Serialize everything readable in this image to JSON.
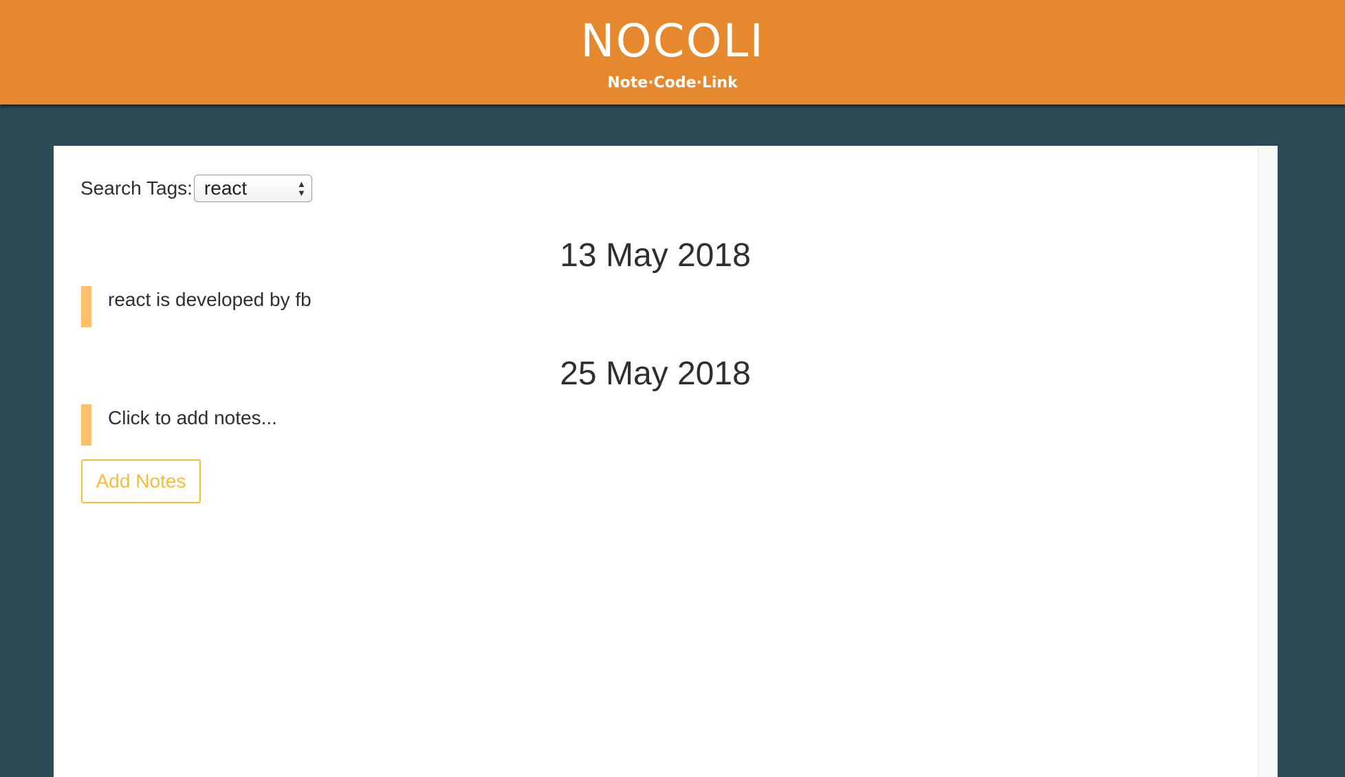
{
  "header": {
    "title": "NOCOLI",
    "subtitle": "Note·Code·Link"
  },
  "search": {
    "label": "Search Tags:",
    "selected_tag": "react"
  },
  "note_groups": [
    {
      "date": "13 May 2018",
      "notes": [
        "react is developed by fb"
      ]
    },
    {
      "date": "25 May 2018",
      "notes": [
        "Click to add notes..."
      ]
    }
  ],
  "actions": {
    "add_notes_label": "Add Notes"
  },
  "colors": {
    "header_bg": "#e6892e",
    "page_bg": "#2a4a56",
    "note_accent": "#ffbf6b",
    "button_accent": "#ffbb33"
  }
}
